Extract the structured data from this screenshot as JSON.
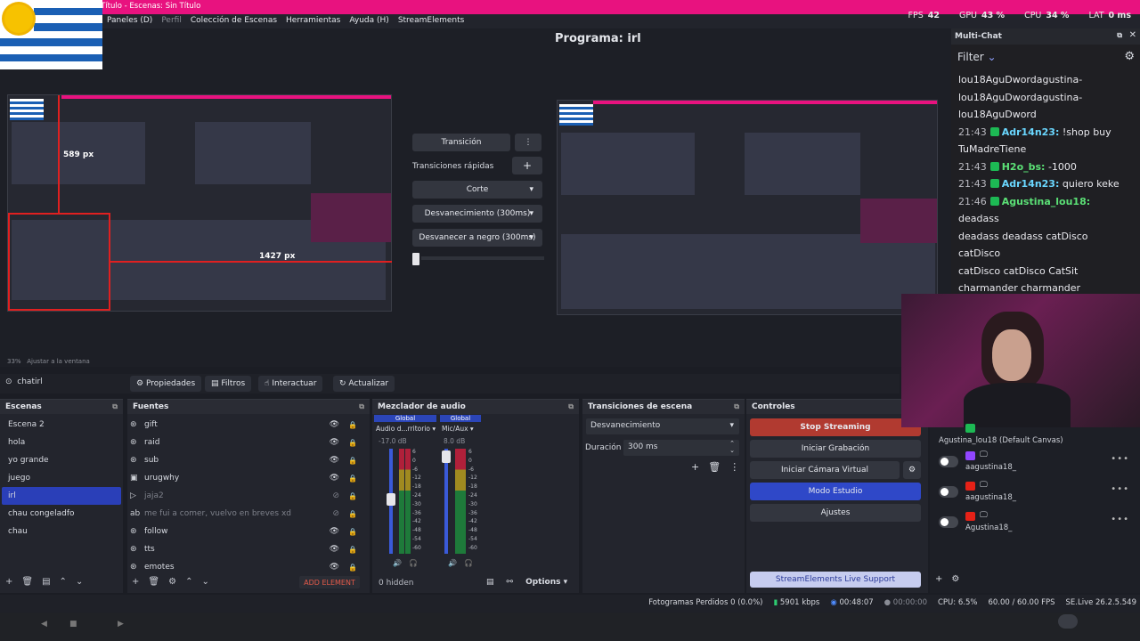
{
  "app": {
    "title": "n Título - Escenas: Sin Título"
  },
  "menu": [
    "Paneles (D)",
    "Perfil",
    "Colección de Escenas",
    "Herramientas",
    "Ayuda (H)",
    "StreamElements"
  ],
  "stats": {
    "fps_label": "FPS",
    "fps": "42",
    "gpu_label": "GPU",
    "gpu": "43 %",
    "cpu_label": "CPU",
    "cpu": "34 %",
    "lat_label": "LAT",
    "lat": "0 ms"
  },
  "program": {
    "title": "Programa: irl"
  },
  "preview_overlay": {
    "w": "589 px",
    "h": "1427 px"
  },
  "zoom": {
    "value": "33%",
    "fit": "Ajustar a la ventana"
  },
  "transition_panel": {
    "transition": "Transición",
    "quick": "Transiciones rápidas",
    "items": [
      "Corte",
      "Desvanecimiento (300ms)",
      "Desvanecer a negro (300ms)"
    ]
  },
  "toolbar": {
    "source": "chatirl",
    "props": "Propiedades",
    "filters": "Filtros",
    "interact": "Interactuar",
    "refresh": "Actualizar"
  },
  "scenes": {
    "title": "Escenas",
    "items": [
      "Escena 2",
      "hola",
      "yo grande",
      "juego",
      "irl",
      "chau congeladfo",
      "chau"
    ],
    "selected": 4
  },
  "sources": {
    "title": "Fuentes",
    "items": [
      {
        "name": "gift",
        "hidden": false
      },
      {
        "name": "raid",
        "hidden": false
      },
      {
        "name": "sub",
        "hidden": false
      },
      {
        "name": "urugwhy",
        "hidden": false
      },
      {
        "name": "jaja2",
        "hidden": true
      },
      {
        "name": "me fui a comer, vuelvo en breves xd",
        "hidden": true
      },
      {
        "name": "follow",
        "hidden": false
      },
      {
        "name": "tts",
        "hidden": false
      },
      {
        "name": "emotes",
        "hidden": false
      }
    ],
    "add": "ADD ELEMENT"
  },
  "mixer": {
    "title": "Mezclador de audio",
    "ch1_tag": "Global",
    "ch1_name": "Audio d...rritorio",
    "ch1_db": "-17.0 dB",
    "ch2_tag": "Global",
    "ch2_name": "Mic/Aux",
    "ch2_db": "8.0 dB",
    "scale": [
      "6",
      "0",
      "-6",
      "-12",
      "-18",
      "-24",
      "-30",
      "-36",
      "-42",
      "-48",
      "-54",
      "-60"
    ],
    "hidden": "0 hidden",
    "options": "Options"
  },
  "scene_transitions": {
    "title": "Transiciones de escena",
    "type": "Desvanecimiento",
    "duration_label": "Duración",
    "duration": "300 ms"
  },
  "controls": {
    "title": "Controles",
    "stream": "Stop Streaming",
    "record": "Iniciar Grabación",
    "vcam": "Iniciar Cámara Virtual",
    "studio": "Modo Estudio",
    "settings": "Ajustes",
    "support": "StreamElements Live Support"
  },
  "status": {
    "dropped": "Fotogramas Perdidos 0 (0.0%)",
    "kbps": "5901 kbps",
    "live_time": "00:48:07",
    "rec_time": "00:00:00",
    "cpu": "CPU: 6.5%",
    "fps": "60.00 / 60.00 FPS",
    "version": "SE.Live 26.2.5.549"
  },
  "chat": {
    "title": "Multi-Chat",
    "filter": "Filter",
    "lines": [
      {
        "time": "",
        "user": "",
        "text": "lou18AguDwordagustina-"
      },
      {
        "time": "",
        "user": "",
        "text": "lou18AguDwordagustina-"
      },
      {
        "time": "",
        "user": "",
        "text": "lou18AguDword"
      },
      {
        "time": "21:43",
        "user": "Adr14n23:",
        "color": "cyan",
        "text": "!shop buy"
      },
      {
        "time": "",
        "user": "",
        "text": "TuMadreTiene"
      },
      {
        "time": "21:43",
        "user": "H2o_bs:",
        "color": "green",
        "text": "-1000"
      },
      {
        "time": "21:43",
        "user": "Adr14n23:",
        "color": "cyan",
        "text": "quiero keke"
      },
      {
        "time": "21:46",
        "user": "Agustina_lou18:",
        "color": "green",
        "text": "deadass"
      },
      {
        "time": "",
        "user": "",
        "text": "deadass deadass catDisco catDisco"
      },
      {
        "time": "",
        "user": "",
        "text": "catDisco catDisco CatSit"
      },
      {
        "time": "",
        "user": "",
        "text": "charmander charmander"
      }
    ]
  },
  "accounts": [
    {
      "name": "Agustina_lou18 (Default Canvas)",
      "platform": "kick"
    },
    {
      "name": "aagustina18_",
      "platform": "twitch"
    },
    {
      "name": "aagustina18_",
      "platform": "youtube"
    },
    {
      "name": "Agustina18_",
      "platform": "youtube"
    }
  ],
  "colors": {
    "accent": "#e8127f",
    "selected": "#2a3fb8",
    "stop": "#b13a30",
    "studio": "#2f48c8"
  }
}
